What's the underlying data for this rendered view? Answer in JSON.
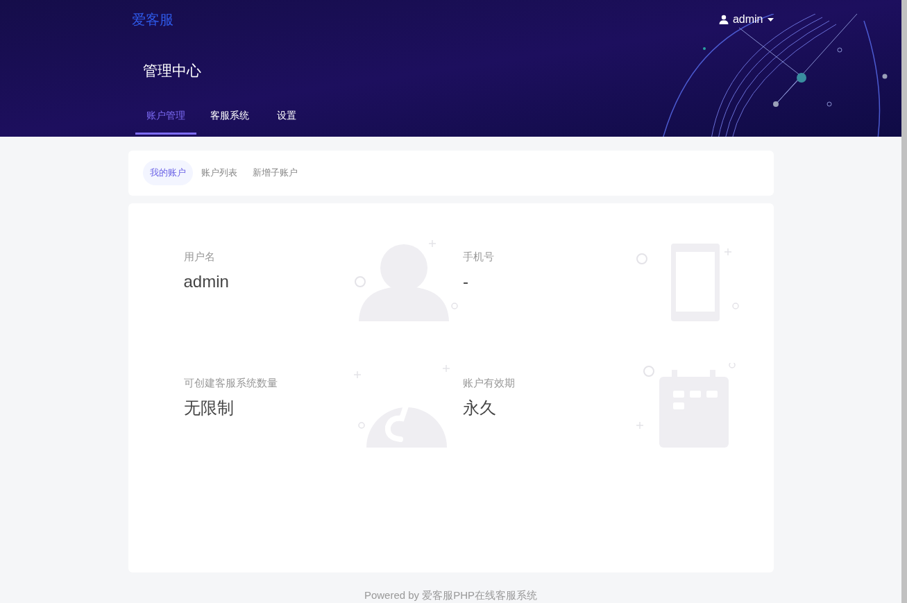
{
  "header": {
    "logo": "爱客服",
    "user": "admin",
    "title": "管理中心"
  },
  "tabs": [
    {
      "label": "账户管理",
      "selected": true
    },
    {
      "label": "客服系统",
      "selected": false
    },
    {
      "label": "设置",
      "selected": false
    }
  ],
  "subtabs": [
    {
      "label": "我的账户",
      "selected": true
    },
    {
      "label": "账户列表",
      "selected": false
    },
    {
      "label": "新增子账户",
      "selected": false
    }
  ],
  "fields": [
    {
      "kind": "user",
      "label": "用户名",
      "value": "admin"
    },
    {
      "kind": "phone",
      "label": "手机号",
      "value": "-"
    },
    {
      "kind": "quota",
      "label": "可创建客服系统数量",
      "value": "无限制"
    },
    {
      "kind": "calendar",
      "label": "账户有效期",
      "value": "永久"
    }
  ],
  "footer": "Powered by 爱客服PHP在线客服系统"
}
